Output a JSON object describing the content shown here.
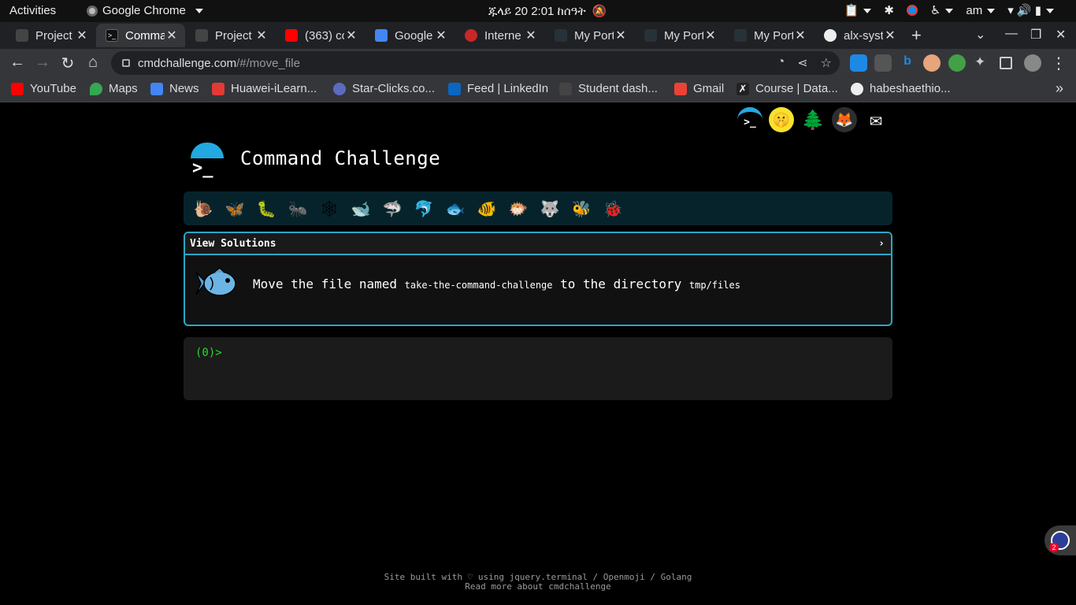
{
  "system_bar": {
    "activities": "Activities",
    "app_name": "Google Chrome",
    "clock": "ጁላይ 20  2:01 ከሰዓት",
    "language": "am"
  },
  "tabs": [
    {
      "title": "Project",
      "color": "#444",
      "active": false
    },
    {
      "title": "Comma",
      "color": "#111",
      "active": true
    },
    {
      "title": "Project",
      "color": "#444",
      "active": false
    },
    {
      "title": "(363) co",
      "color": "#ff0000",
      "active": false
    },
    {
      "title": "Google",
      "color": "#4285f4",
      "active": false
    },
    {
      "title": "Interne",
      "color": "#c62828",
      "active": false
    },
    {
      "title": "My Port",
      "color": "#263238",
      "active": false
    },
    {
      "title": "My Port",
      "color": "#263238",
      "active": false
    },
    {
      "title": "My Port",
      "color": "#263238",
      "active": false
    },
    {
      "title": "alx-syst",
      "color": "#eeeeee",
      "active": false
    }
  ],
  "address_bar": {
    "host": "cmdchallenge.com",
    "path": "/#/move_file"
  },
  "bookmarks": [
    {
      "label": "YouTube",
      "color": "#ff0000"
    },
    {
      "label": "Maps",
      "color": "#34a853"
    },
    {
      "label": "News",
      "color": "#4285f4"
    },
    {
      "label": "Huawei-iLearn...",
      "color": "#e53935"
    },
    {
      "label": "Star-Clicks.co...",
      "color": "#5c6bc0"
    },
    {
      "label": "Feed | LinkedIn",
      "color": "#0a66c2"
    },
    {
      "label": "Student dash...",
      "color": "#444444"
    },
    {
      "label": "Gmail",
      "color": "#ea4335"
    },
    {
      "label": "Course | Data...",
      "color": "#222222"
    },
    {
      "label": "habeshaethio...",
      "color": "#eeeeee"
    }
  ],
  "page": {
    "title": "Command Challenge",
    "prompt_symbol": ">_",
    "levels": [
      "🐌",
      "🦋",
      "🐛",
      "🐜",
      "🕸",
      "🐋",
      "🦈",
      "🐬",
      "🐟",
      "🐠",
      "🐡",
      "🐺",
      "🐝",
      "🐞"
    ],
    "view_solutions": "View Solutions",
    "chevron": "›",
    "challenge": {
      "prefix": "Move the file named ",
      "filename": "take-the-command-challenge",
      "middle": " to the directory ",
      "directory": "tmp/files"
    },
    "terminal_prompt": "(0)>",
    "footer_line1": "Site built with ♡ using jquery.terminal / Openmoji / Golang",
    "footer_line2": "Read more about cmdchallenge",
    "bot_badge": "2"
  },
  "colors": {
    "accent": "#2aa6c7",
    "terminal_green": "#2bd92b",
    "level_bar": "#06232b"
  }
}
